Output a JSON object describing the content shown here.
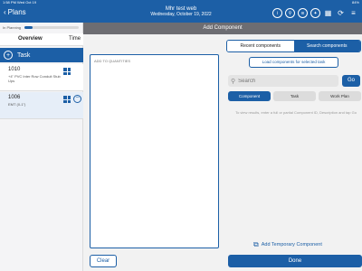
{
  "status_bar": {
    "time": "1:58 PM  Wed Oct 19",
    "battery": "84%"
  },
  "nav": {
    "back_label": "Plans",
    "title": "Mhr test web",
    "subtitle": "Wednesday, October 19, 2022",
    "icons": [
      "info-icon",
      "person-search-icon",
      "layers-icon",
      "compass-icon",
      "grid-icon",
      "sync-icon",
      "menu-icon"
    ]
  },
  "left": {
    "status_label": "In Planning",
    "progress": 0.15,
    "tabs": [
      "Overview",
      "Time"
    ],
    "task_header": "Task",
    "tasks": [
      {
        "number": "1010",
        "description": "+4\" PVC Inter Row Conduit Stub Ups"
      },
      {
        "number": "1006",
        "description": "EMT (0-1\")"
      }
    ]
  },
  "modal": {
    "title": "Add Component",
    "textarea_placeholder": "ADD TO QUANTITIES",
    "clear_label": "Clear",
    "segment": {
      "recent": "Recent components",
      "search": "Search components"
    },
    "load_label": "Load components for selected task",
    "search_placeholder": "Search",
    "go_label": "Go",
    "filters": [
      "Component",
      "Task",
      "Work Plan"
    ],
    "hint": "To view results, enter a full or partial Component ID, Description and tap Go",
    "add_temp_label": "Add Temporary Component",
    "done_label": "Done"
  }
}
